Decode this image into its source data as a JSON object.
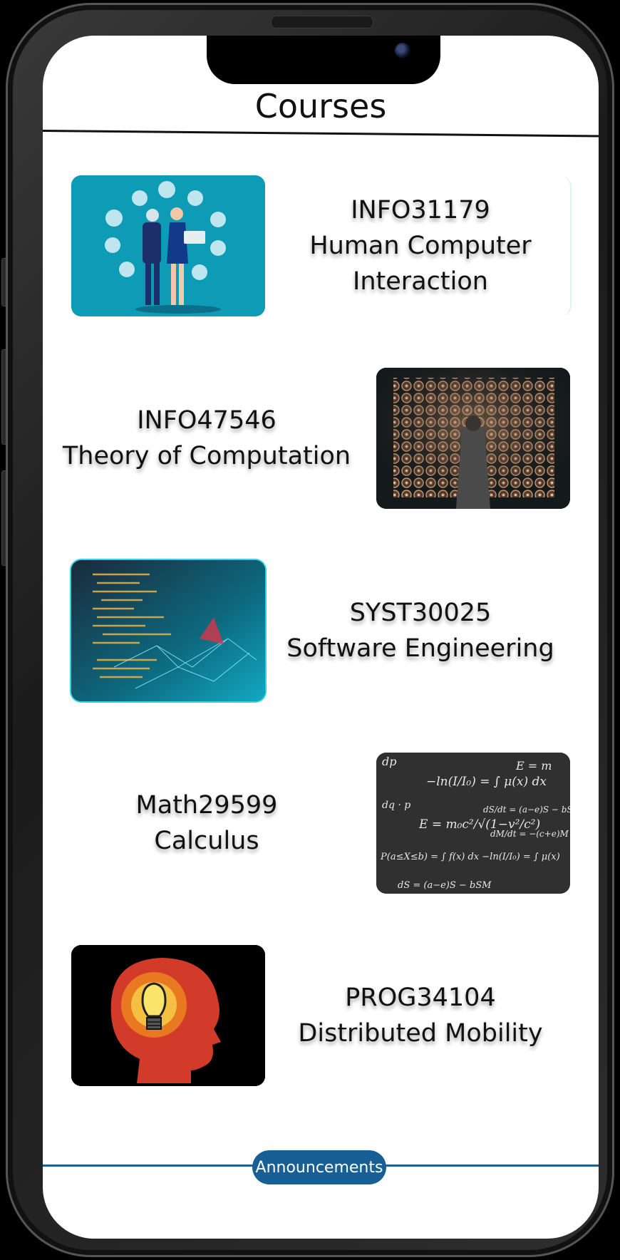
{
  "header": {
    "title": "Courses"
  },
  "courses": [
    {
      "code": "INFO31179",
      "name_line1": "Human Computer",
      "name_line2": "Interaction",
      "image": "hci-robot-illustration"
    },
    {
      "code": "INFO47546",
      "name_line1": "Theory of Computation",
      "name_line2": "",
      "image": "enigma-machine-photo"
    },
    {
      "code": "SYST30025",
      "name_line1": "Software Engineering",
      "name_line2": "",
      "image": "code-network-photo"
    },
    {
      "code": "Math29599",
      "name_line1": "Calculus",
      "name_line2": "",
      "image": "chalkboard-equations-photo"
    },
    {
      "code": "PROG34104",
      "name_line1": "Distributed Mobility",
      "name_line2": "",
      "image": "lightbulb-head-illustration"
    }
  ],
  "footer": {
    "announcements_label": "Announcements"
  },
  "colors": {
    "accent": "#185f96",
    "line": "#1f5f91",
    "teal": "#0e9bb5"
  }
}
